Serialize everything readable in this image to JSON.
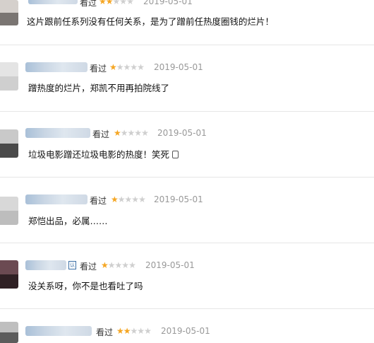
{
  "comments": [
    {
      "watched": "看过",
      "rating": 2,
      "date": "2019-05-01",
      "text": "这片跟前任系列没有任何关系，是为了蹭前任热度圈钱的烂片！"
    },
    {
      "watched": "看过",
      "rating": 1,
      "date": "2019-05-01",
      "text": "蹭热度的烂片，郑凯不用再拍院线了"
    },
    {
      "watched": "看过",
      "rating": 1,
      "date": "2019-05-01",
      "text": "垃圾电影蹭还垃圾电影的热度！笑死"
    },
    {
      "watched": "看过",
      "rating": 1,
      "date": "2019-05-01",
      "text": "郑恺出品，必属……"
    },
    {
      "watched": "看过",
      "rating": 1,
      "date": "2019-05-01",
      "text": "没关系呀，你不是也看吐了吗"
    },
    {
      "watched": "看过",
      "rating": 2,
      "date": "2019-05-01",
      "text": ""
    }
  ],
  "stars_total": 5,
  "colors": {
    "star_on": "#f5a623",
    "star_off": "#cfcfcf",
    "date": "#999999",
    "divider": "#e6e6e6"
  },
  "icons": {
    "emoji": "phone-like-emoji-icon",
    "badge": "verified-badge-icon"
  }
}
